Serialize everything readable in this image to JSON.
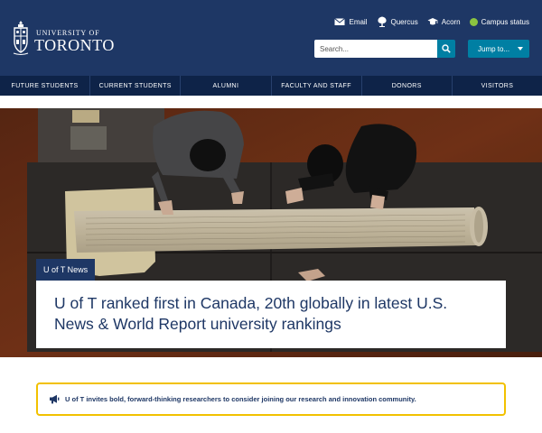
{
  "brand": {
    "name_top": "UNIVERSITY OF",
    "name_main": "TORONTO"
  },
  "utility_links": [
    {
      "label": "Email",
      "icon": "envelope-icon"
    },
    {
      "label": "Quercus",
      "icon": "quercus-icon"
    },
    {
      "label": "Acorn",
      "icon": "graduation-cap-icon"
    },
    {
      "label": "Campus status",
      "icon": "status-dot-icon",
      "status_color": "#8bc440"
    }
  ],
  "search": {
    "placeholder": "Search..."
  },
  "jump": {
    "label": "Jump to..."
  },
  "nav": {
    "items": [
      {
        "label": "FUTURE STUDENTS"
      },
      {
        "label": "CURRENT STUDENTS"
      },
      {
        "label": "ALUMNI"
      },
      {
        "label": "FACULTY AND STAFF"
      },
      {
        "label": "DONORS"
      },
      {
        "label": "VISITORS"
      }
    ]
  },
  "hero": {
    "tag": "U of T News",
    "headline": "U of T ranked first in Canada, 20th globally in latest U.S. News & World Report university rankings"
  },
  "notice": {
    "icon": "megaphone-icon",
    "text": "U of T invites bold, forward-thinking researchers to consider joining our research and innovation community."
  },
  "colors": {
    "header_bg": "#1e3765",
    "nav_bg": "#0e2348",
    "accent": "#007fa3",
    "notice_border": "#f2c100"
  }
}
